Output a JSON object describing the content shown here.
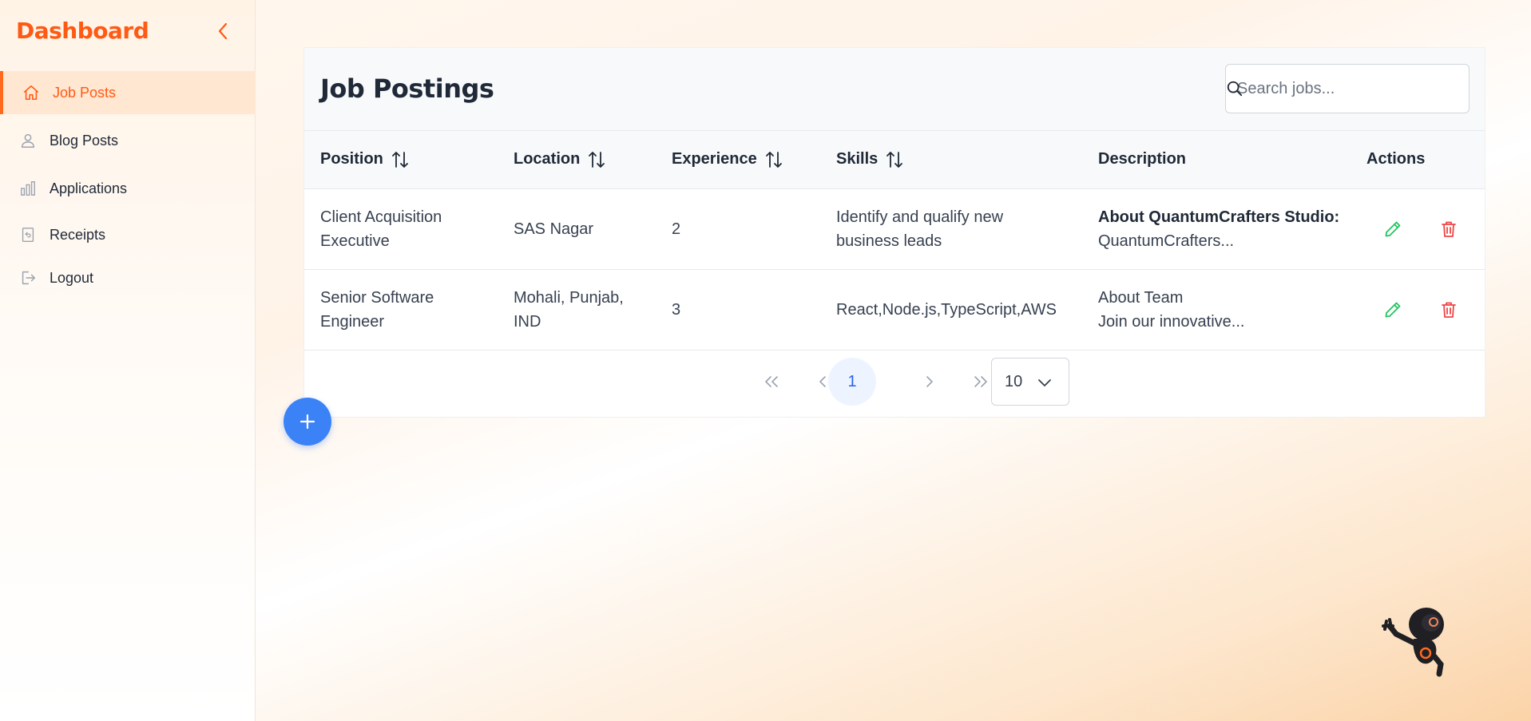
{
  "sidebar": {
    "brand": "Dashboard",
    "items": [
      {
        "label": "Job Posts",
        "icon": "home-icon",
        "active": true
      },
      {
        "label": "Blog Posts",
        "icon": "user-icon",
        "active": false
      },
      {
        "label": "Applications",
        "icon": "bar-chart-icon",
        "active": false
      },
      {
        "label": "Receipts",
        "icon": "receipt-icon",
        "active": false
      },
      {
        "label": "Logout",
        "icon": "logout-icon",
        "active": false
      }
    ]
  },
  "main": {
    "title": "Job Postings",
    "search": {
      "placeholder": "Search jobs...",
      "value": ""
    },
    "columns": [
      "Position",
      "Location",
      "Experience",
      "Skills",
      "Description",
      "Actions"
    ],
    "rows": [
      {
        "position": "Client Acquisition Executive",
        "location": "SAS Nagar",
        "experience": "2",
        "skills": "Identify and qualify new business leads",
        "description_bold": "About QuantumCrafters Studio:",
        "description_rest": " QuantumCrafters..."
      },
      {
        "position": "Senior Software Engineer",
        "location": "Mohali, Punjab, IND",
        "experience": "3",
        "skills": "React,Node.js,TypeScript,AWS",
        "description_line1": "About Team",
        "description_line2": "Join our innovative..."
      }
    ],
    "pagination": {
      "first": "«",
      "prev": "‹",
      "current_page": "1",
      "next": "›",
      "last": "»",
      "page_size": "10"
    }
  },
  "colors": {
    "accent": "#ff5a14",
    "primary": "#3b82f6",
    "edit": "#22c55e",
    "delete": "#ef4444"
  }
}
